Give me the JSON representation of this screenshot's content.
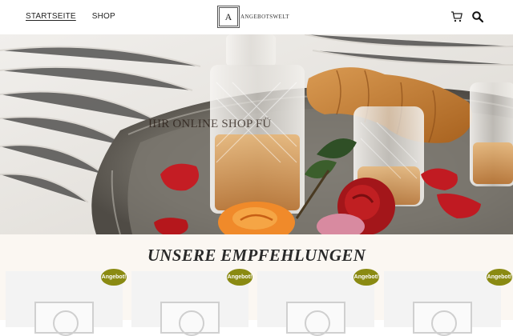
{
  "nav": {
    "home": "STARTSEITE",
    "shop": "SHOP"
  },
  "logo": {
    "letter": "A",
    "text": "ANGEBOTSWELT"
  },
  "hero": {
    "caption": "IHR ONLINE SHOP FÜ"
  },
  "recommendations": {
    "title": "UNSERE EMPFEHLUNGEN",
    "badges": [
      "Angebot!",
      "Angebot!",
      "Angebot!",
      "Angebot!"
    ]
  },
  "icons": [
    "cart-icon",
    "search-icon"
  ],
  "colors": {
    "badge": "#8a8a12",
    "section_bg": "#fbf7f2"
  }
}
